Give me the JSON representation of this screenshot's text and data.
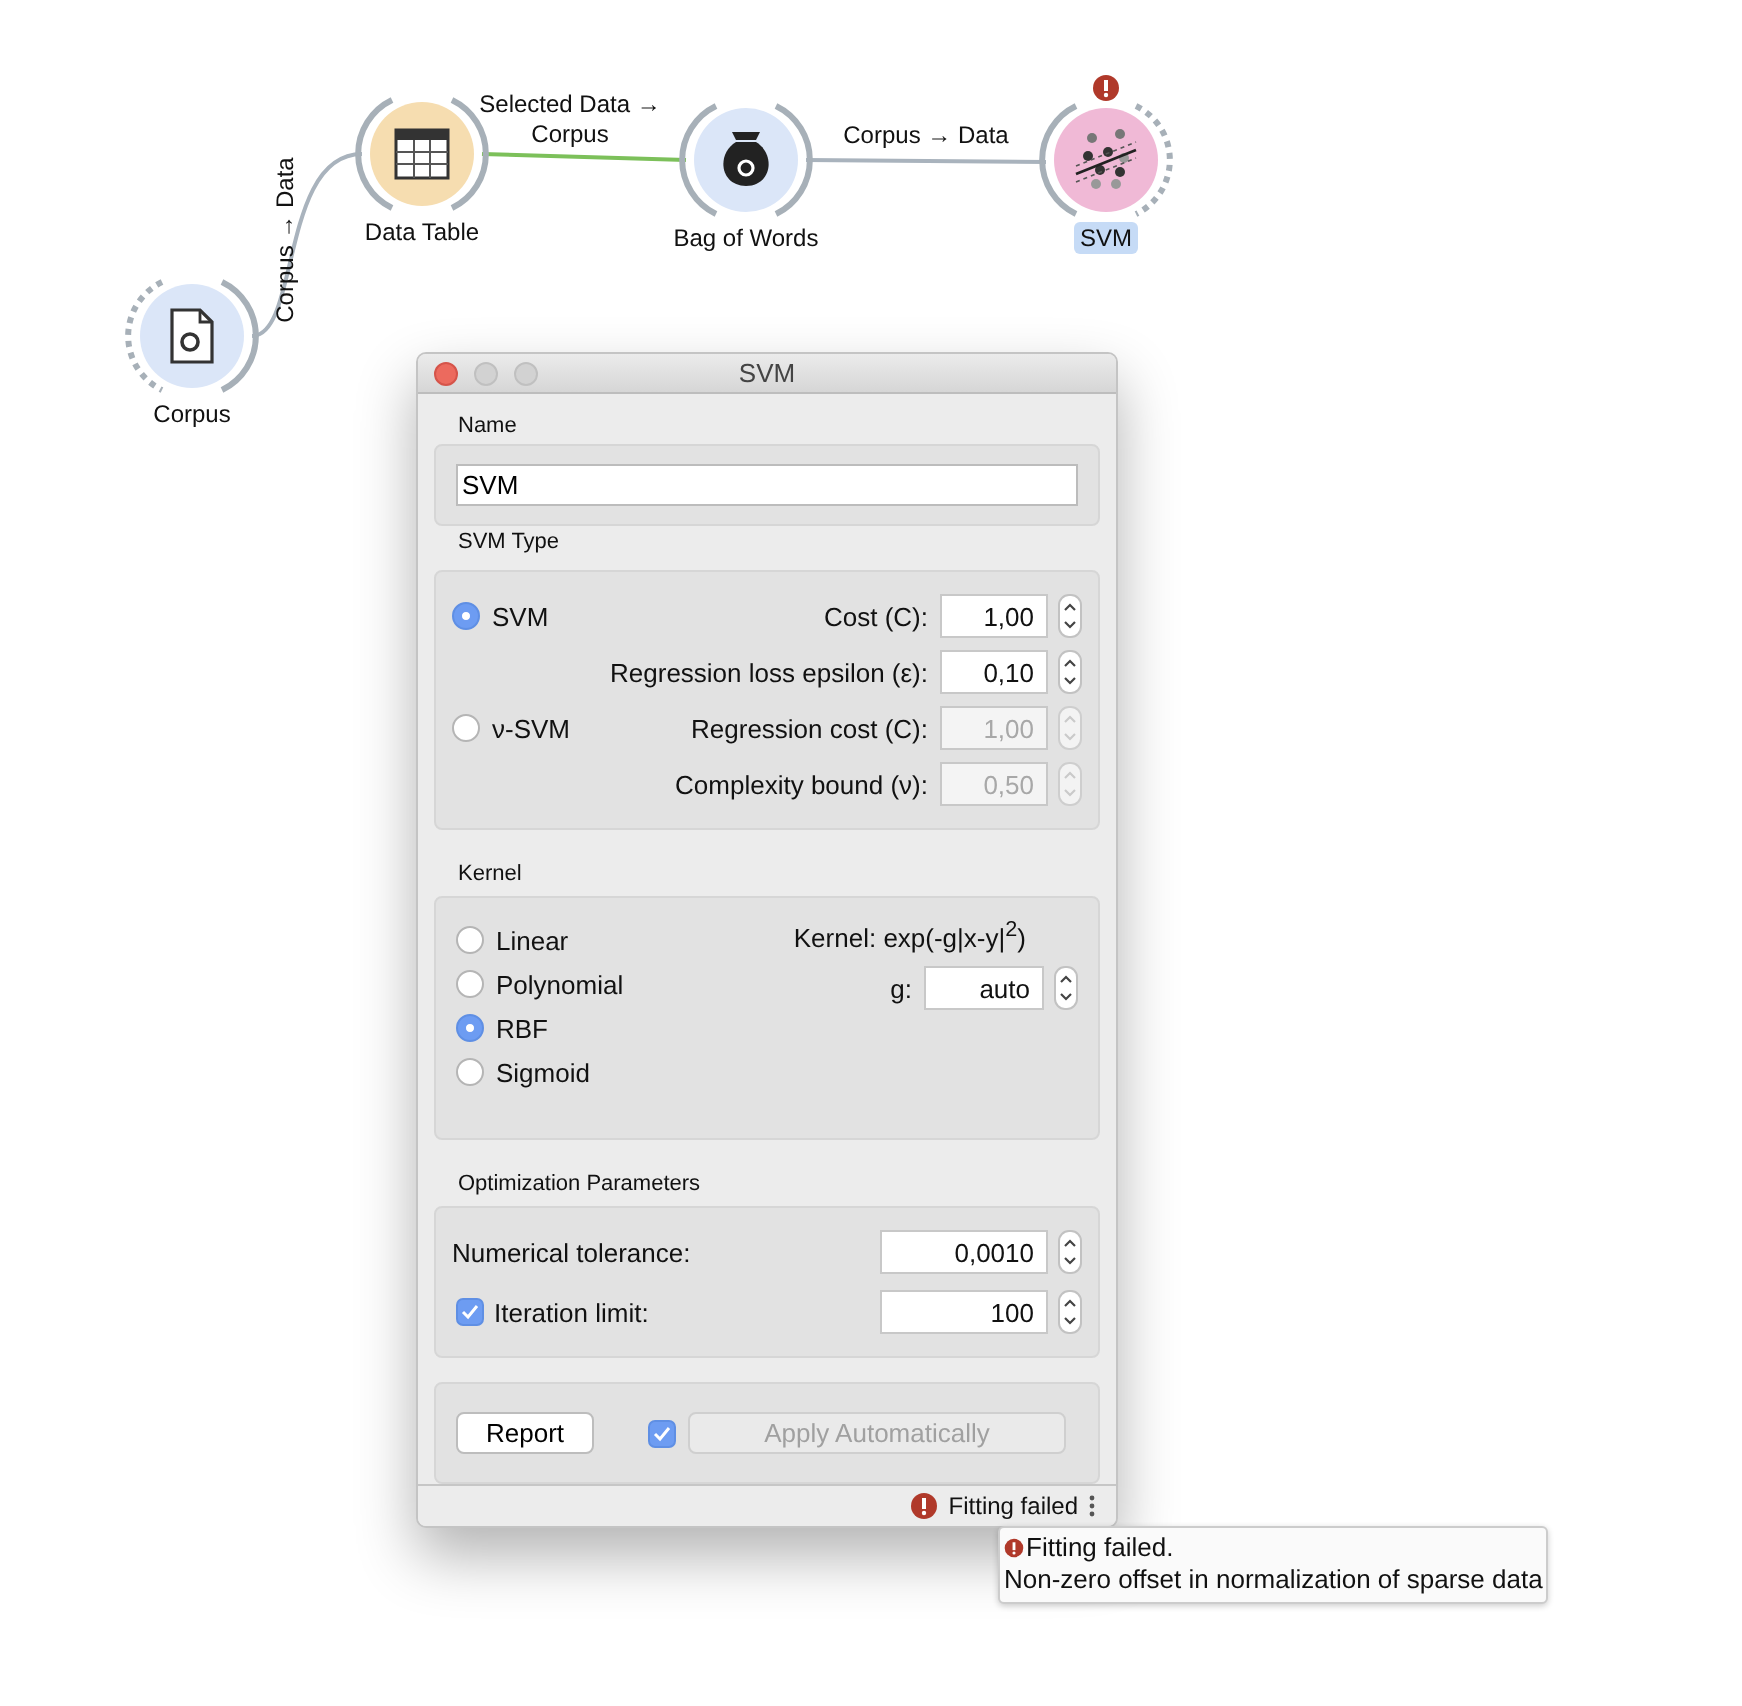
{
  "workflow": {
    "nodes": [
      {
        "label": "Corpus",
        "kind": "corpus",
        "selected": false,
        "warning": false
      },
      {
        "label": "Data Table",
        "kind": "table",
        "selected": false,
        "warning": false
      },
      {
        "label": "Bag of Words",
        "kind": "bag",
        "selected": false,
        "warning": false
      },
      {
        "label": "SVM",
        "kind": "svm",
        "selected": true,
        "warning": true
      }
    ],
    "links": [
      {
        "label": "Corpus → Data",
        "color": "#a9b3bd"
      },
      {
        "label": "Selected Data → Corpus",
        "color": "#7cc05a"
      },
      {
        "label": "Corpus → Data",
        "color": "#a9b3bd"
      }
    ]
  },
  "dialog": {
    "title": "SVM",
    "name": {
      "title": "Name",
      "value": "SVM"
    },
    "svm_type": {
      "title": "SVM Type",
      "options": [
        {
          "label": "SVM",
          "selected": true,
          "params": [
            {
              "label": "Cost (C):",
              "value": "1,00",
              "disabled": false
            },
            {
              "label": "Regression loss epsilon (ε):",
              "value": "0,10",
              "disabled": false
            }
          ]
        },
        {
          "label": "ν-SVM",
          "selected": false,
          "params": [
            {
              "label": "Regression cost (C):",
              "value": "1,00",
              "disabled": true
            },
            {
              "label": "Complexity bound (ν):",
              "value": "0,50",
              "disabled": true
            }
          ]
        }
      ]
    },
    "kernel": {
      "title": "Kernel",
      "options": [
        {
          "label": "Linear",
          "selected": false
        },
        {
          "label": "Polynomial",
          "selected": false
        },
        {
          "label": "RBF",
          "selected": true
        },
        {
          "label": "Sigmoid",
          "selected": false
        }
      ],
      "formula": "Kernel: exp(-g|x-y|$^{2}$)",
      "params": [
        {
          "label": "g:",
          "value": "auto"
        }
      ]
    },
    "optimization": {
      "title": "Optimization Parameters",
      "params": [
        {
          "kind": "plain",
          "label": "Numerical tolerance:",
          "value": "0,0010"
        },
        {
          "kind": "checkbox",
          "label": "Iteration limit:",
          "value": "100",
          "checked": true
        }
      ]
    },
    "report_button": "Report",
    "auto_apply": {
      "label": "Apply Automatically",
      "checked": true,
      "disabled": true
    },
    "status_bar": {
      "message": "Fitting failed"
    }
  },
  "tooltip": {
    "lines": [
      "Fitting failed.",
      "Non-zero offset in normalization of sparse data"
    ]
  }
}
